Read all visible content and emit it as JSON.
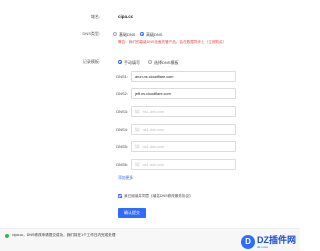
{
  "domain_row": {
    "label": "域名:",
    "value": "cipa.cc"
  },
  "dns_type": {
    "label": "DNS类型:",
    "options": [
      "基础DNS",
      "高级DNS"
    ],
    "selected": "高级DNS",
    "warning": "警告：我们的高级DNS全面托管产品，会在数据同步上（立即购买）"
  },
  "record_mode": {
    "label": "记录模板:",
    "options": [
      "手动填写",
      "选择DNS模板"
    ],
    "selected": "手动填写"
  },
  "nameservers": [
    {
      "label": "DNS1:",
      "value": "arun.ns.cloudflare.com",
      "placeholder": ""
    },
    {
      "label": "DNS2:",
      "value": "jeff.ns.cloudflare.com",
      "placeholder": ""
    },
    {
      "label": "DNS3:",
      "value": "",
      "placeholder": "如：ns1.dns.com"
    },
    {
      "label": "DNS4:",
      "value": "",
      "placeholder": "如：ns1.dns.com"
    },
    {
      "label": "DNS5:",
      "value": "",
      "placeholder": "如：ns1.dns.com"
    },
    {
      "label": "DNS6:",
      "value": "",
      "placeholder": "如：ns1.dns.com"
    }
  ],
  "add_more_label": "添加更多",
  "agreement": {
    "checked": true,
    "text": "我已阅读并同意《域名DNS修改服务协议》"
  },
  "submit_label": "确认提交",
  "status_bar": {
    "text": "cipa.cc，DNS修改申请提交成功，我们将在1个工作日内完成处理",
    "color": "#3bb54a"
  },
  "watermark": {
    "logo": "D",
    "title": "DZ插件网",
    "subtitle": "dz-x.net"
  }
}
